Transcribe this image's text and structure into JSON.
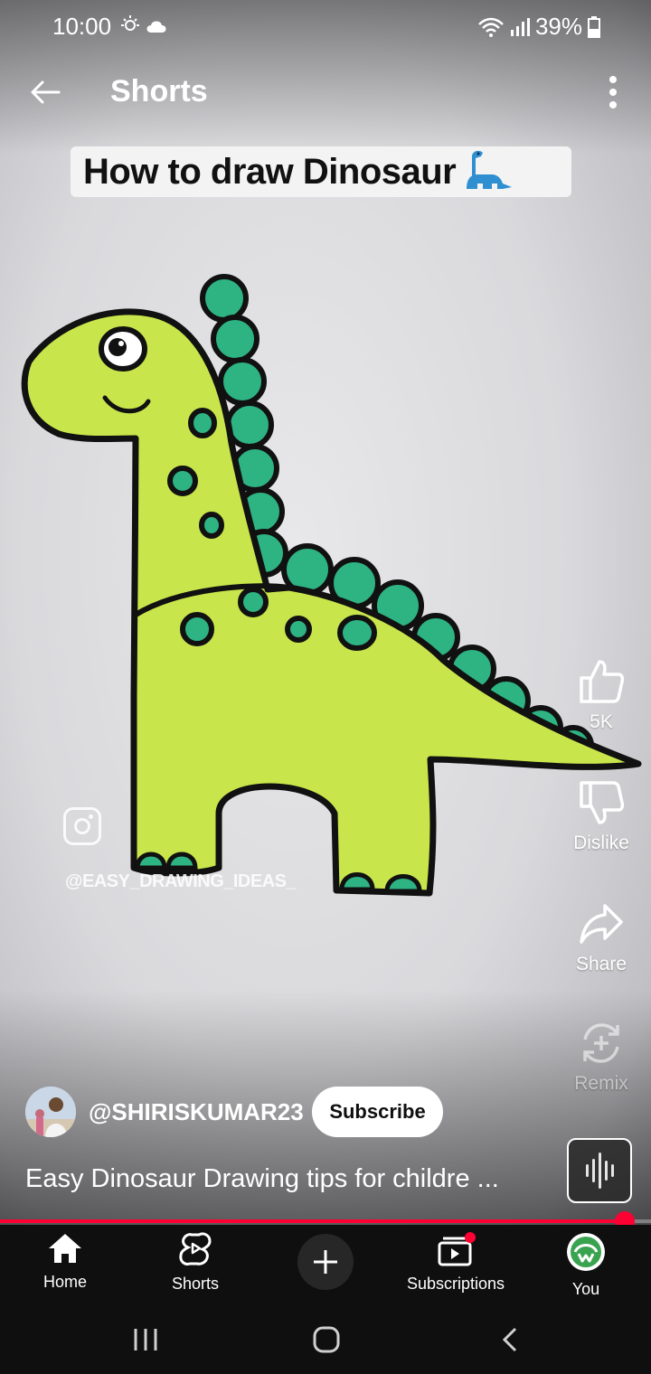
{
  "status_bar": {
    "time": "10:00",
    "battery": "39%"
  },
  "header": {
    "title": "Shorts"
  },
  "video": {
    "overlay_title": "How to draw Dinosaur",
    "watermark": "@EASY_DRAWING_IDEAS_",
    "progress_fraction": 0.96
  },
  "actions": {
    "like_count": "5K",
    "dislike_label": "Dislike",
    "share_label": "Share",
    "remix_label": "Remix"
  },
  "channel": {
    "handle": "@SHIRISKUMAR23",
    "subscribe_label": "Subscribe"
  },
  "description": "Easy Dinosaur Drawing tips for childre ...",
  "bottom_nav": {
    "items": [
      {
        "label": "Home",
        "icon": "home-icon"
      },
      {
        "label": "Shorts",
        "icon": "shorts-icon"
      },
      {
        "label": "",
        "icon": "plus-icon"
      },
      {
        "label": "Subscriptions",
        "icon": "subscriptions-icon"
      },
      {
        "label": "You",
        "icon": "profile-avatar"
      }
    ]
  },
  "colors": {
    "accent": "#ff0033",
    "dino_body": "#c8e64b",
    "dino_spikes": "#2eb383"
  }
}
